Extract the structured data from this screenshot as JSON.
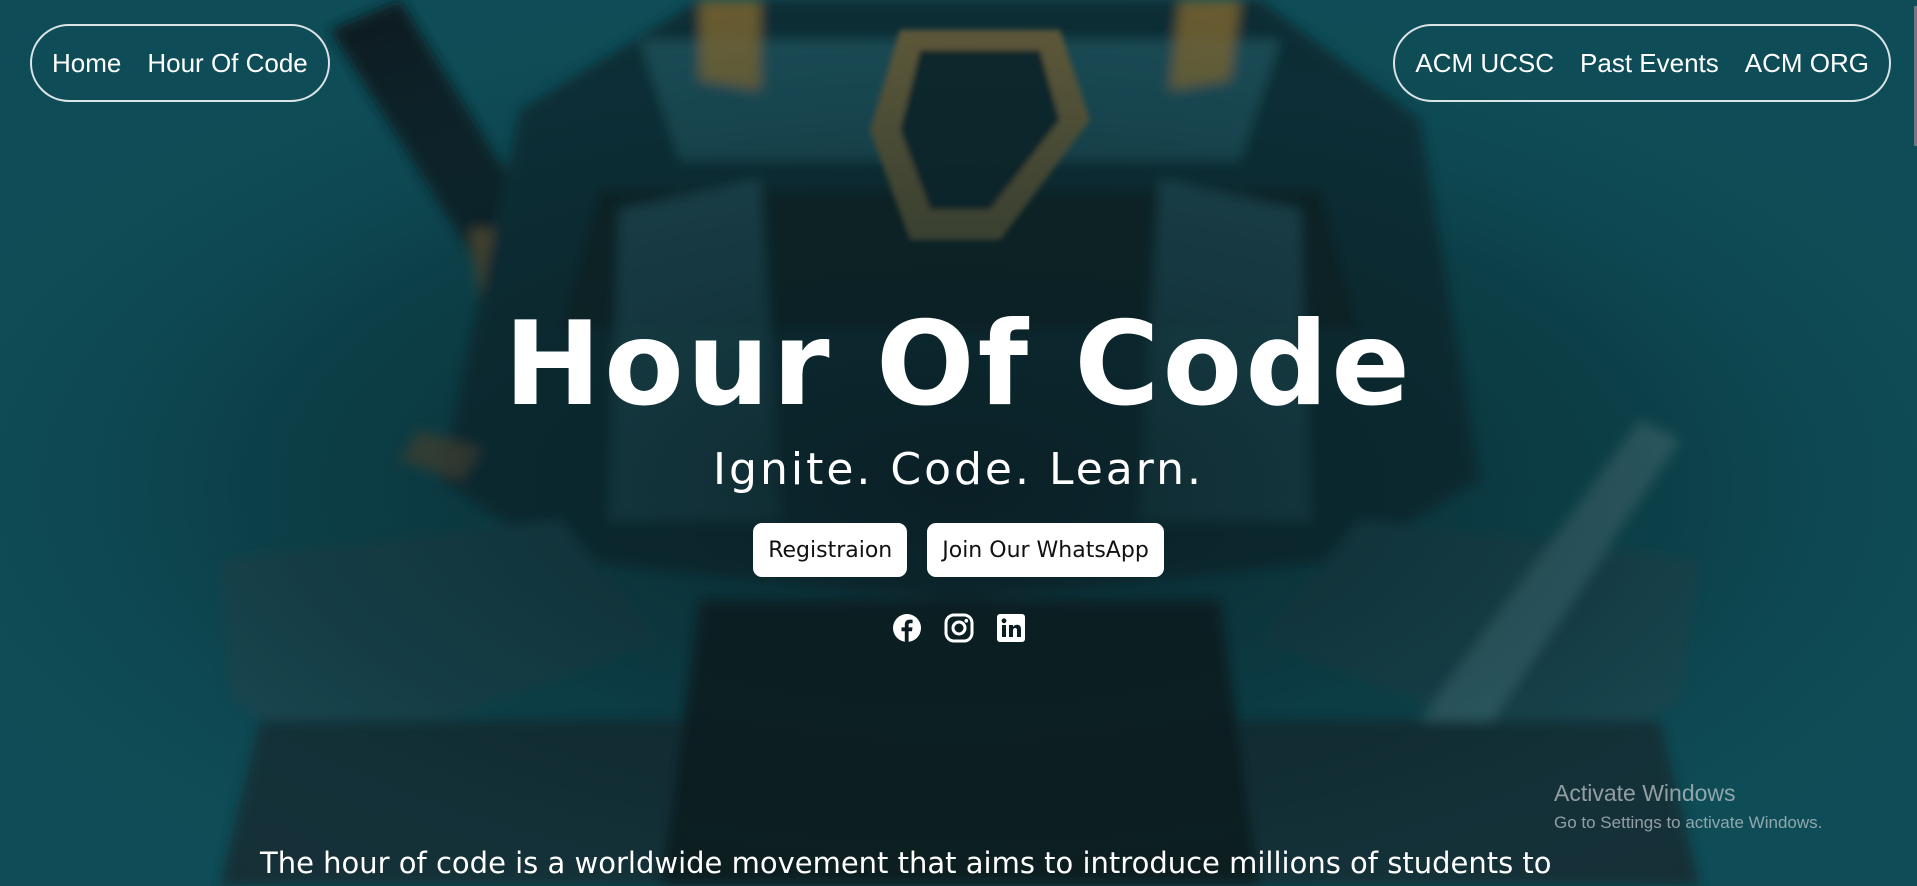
{
  "nav_left": {
    "home": "Home",
    "hour_of_code": "Hour Of Code"
  },
  "nav_right": {
    "acm_ucsc": "ACM UCSC",
    "past_events": "Past Events",
    "acm_org": "ACM ORG"
  },
  "hero": {
    "title": "Hour Of Code",
    "tagline": "Ignite.  Code.  Learn.",
    "registration_button": "Registraion",
    "whatsapp_button": "Join Our WhatsApp"
  },
  "social_icons": [
    "facebook-icon",
    "instagram-icon",
    "linkedin-icon"
  ],
  "intro_text": "The hour of code is a worldwide movement that aims to introduce millions of students to",
  "watermark": {
    "title": "Activate Windows",
    "subtitle": "Go to Settings to activate Windows."
  },
  "colors": {
    "background": "#0e4d57",
    "text": "#ffffff",
    "button_bg": "#ffffff"
  }
}
